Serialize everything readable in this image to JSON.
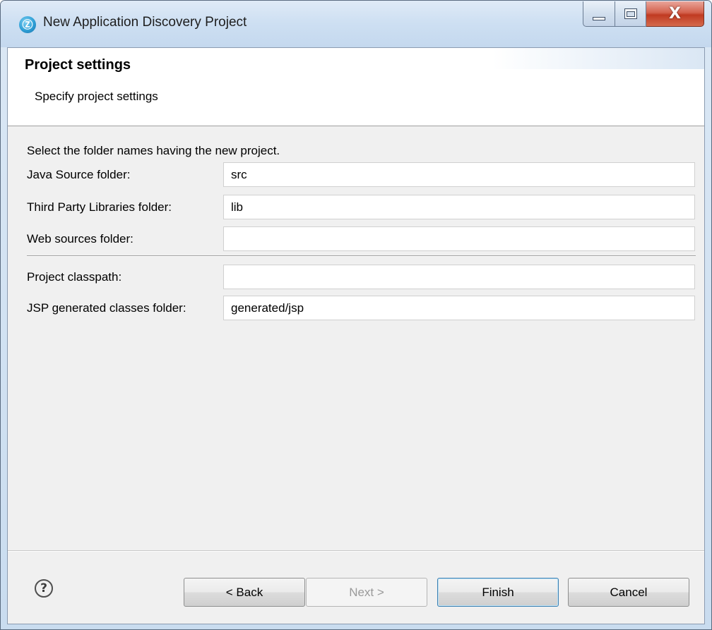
{
  "window": {
    "title": "New Application Discovery Project",
    "icon": "app-discovery-icon",
    "controls": {
      "minimize": "minimize-icon",
      "maximize": "maximize-icon",
      "close": "close-icon",
      "close_glyph": "X"
    }
  },
  "header": {
    "title": "Project settings",
    "description": "Specify project settings"
  },
  "form": {
    "instruction": "Select the folder names having the new project.",
    "fields": [
      {
        "label": "Java Source folder:",
        "value": "src"
      },
      {
        "label": "Third Party Libraries folder:",
        "value": "lib"
      },
      {
        "label": "Web sources folder:",
        "value": ""
      },
      {
        "label": "Project classpath:",
        "value": ""
      },
      {
        "label": "JSP generated classes folder:",
        "value": "generated/jsp"
      }
    ]
  },
  "footer": {
    "help_glyph": "?",
    "buttons": {
      "back": "< Back",
      "next": "Next >",
      "finish": "Finish",
      "cancel": "Cancel"
    },
    "next_enabled": false
  }
}
